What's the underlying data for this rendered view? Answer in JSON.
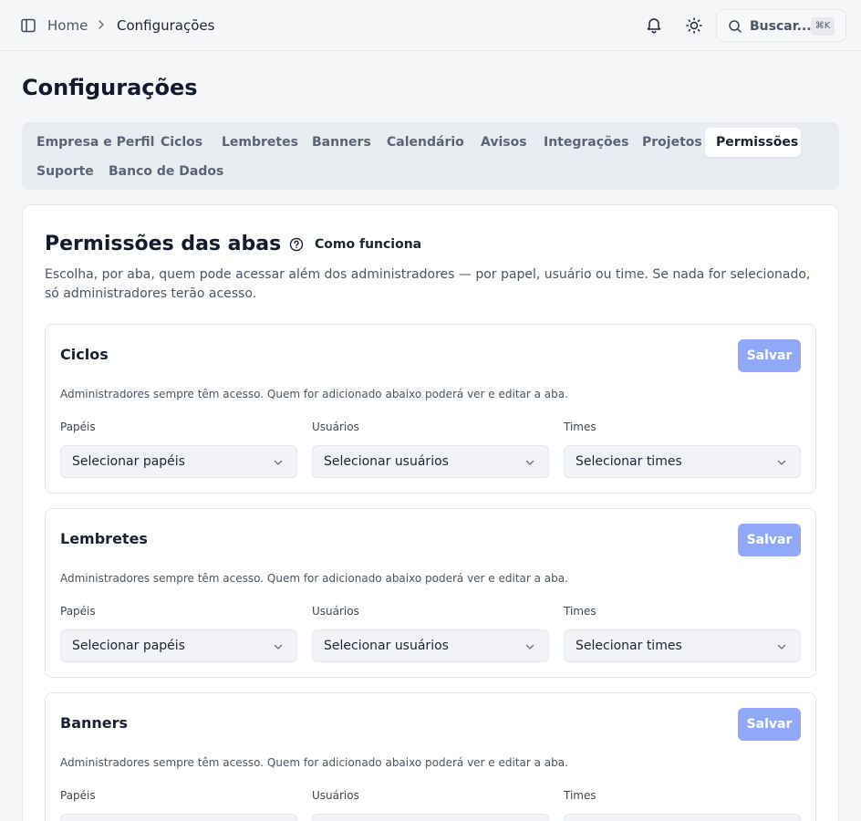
{
  "breadcrumb": {
    "home": "Home",
    "current": "Configurações"
  },
  "header": {
    "search_label": "Buscar...",
    "search_shortcut": "⌘K",
    "icons": [
      "sidebar-toggle-icon",
      "bell-icon",
      "sun-icon",
      "search-icon"
    ]
  },
  "page": {
    "title": "Configurações"
  },
  "tabs": [
    {
      "label": "Empresa e Perfil"
    },
    {
      "label": "Ciclos"
    },
    {
      "label": "Lembretes"
    },
    {
      "label": "Banners"
    },
    {
      "label": "Calendário"
    },
    {
      "label": "Avisos"
    },
    {
      "label": "Integrações"
    },
    {
      "label": "Projetos"
    },
    {
      "label": "Permissões",
      "active": true
    },
    {
      "label": "Suporte"
    },
    {
      "label": "Banco de Dados"
    }
  ],
  "section": {
    "title": "Permissões das abas",
    "help_label": "Como funciona",
    "description": "Escolha, por aba, quem pode acessar além dos administradores — por papel, usuário ou time. Se nada for selecionado, só administradores terão acesso."
  },
  "labels": {
    "save": "Salvar",
    "note": "Administradores sempre têm acesso. Quem for adicionado abaixo poderá ver e editar a aba.",
    "roles": "Papéis",
    "users": "Usuários",
    "teams": "Times",
    "roles_placeholder": "Selecionar papéis",
    "users_placeholder": "Selecionar usuários",
    "teams_placeholder": "Selecionar times"
  },
  "permission_cards": [
    {
      "title": "Ciclos"
    },
    {
      "title": "Lembretes"
    },
    {
      "title": "Banners"
    }
  ],
  "colors": {
    "accent_disabled": "#8fa8f7",
    "background": "#f5f6f8",
    "title": "#141a2e"
  }
}
